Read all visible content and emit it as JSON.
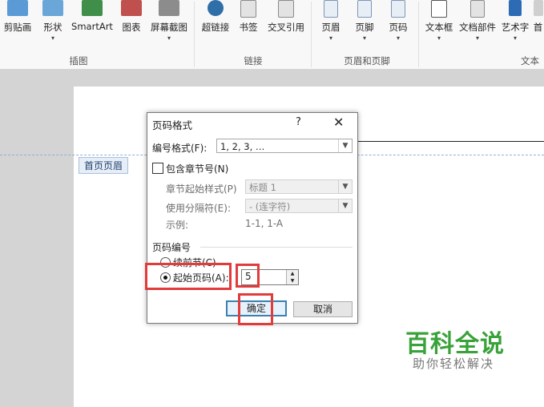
{
  "ribbon": {
    "buttons": [
      {
        "label": "剪贴画",
        "icon": "clipart-icon",
        "has_arrow": false
      },
      {
        "label": "形状",
        "icon": "shapes-icon",
        "has_arrow": true
      },
      {
        "label": "SmartArt",
        "icon": "smartart-icon",
        "has_arrow": false
      },
      {
        "label": "图表",
        "icon": "chart-icon",
        "has_arrow": false
      },
      {
        "label": "屏幕截图",
        "icon": "screenshot-icon",
        "has_arrow": true
      },
      {
        "label": "超链接",
        "icon": "hyperlink-icon",
        "has_arrow": false
      },
      {
        "label": "书签",
        "icon": "bookmark-icon",
        "has_arrow": false
      },
      {
        "label": "交叉引用",
        "icon": "cross-reference-icon",
        "has_arrow": false
      },
      {
        "label": "页眉",
        "icon": "header-icon",
        "has_arrow": true
      },
      {
        "label": "页脚",
        "icon": "footer-icon",
        "has_arrow": true
      },
      {
        "label": "页码",
        "icon": "page-number-icon",
        "has_arrow": true
      },
      {
        "label": "文本框",
        "icon": "textbox-icon",
        "has_arrow": true
      },
      {
        "label": "文档部件",
        "icon": "quick-parts-icon",
        "has_arrow": true
      },
      {
        "label": "艺术字",
        "icon": "wordart-icon",
        "has_arrow": true
      },
      {
        "label": "首",
        "icon": "drop-cap-icon",
        "has_arrow": false
      }
    ],
    "groups": [
      "插图",
      "链接",
      "页眉和页脚",
      "文本"
    ]
  },
  "document": {
    "header_tag": "首页页眉"
  },
  "dialog": {
    "title": "页码格式",
    "help": "?",
    "close": "✕",
    "number_format_label": "编号格式(F):",
    "number_format_value": "1, 2, 3, …",
    "include_chapter_label": "包含章节号(N)",
    "include_chapter_checked": false,
    "chapter_style_label": "章节起始样式(P)",
    "chapter_style_value": "标题 1",
    "separator_label": "使用分隔符(E):",
    "separator_value": "-  (连字符)",
    "example_label": "示例:",
    "example_value": "1-1, 1-A",
    "page_numbering_label": "页码编号",
    "continue_label": "续前节(C)",
    "start_at_label": "起始页码(A):",
    "start_at_selected": true,
    "start_at_value": "5",
    "ok_label": "确定",
    "cancel_label": "取消"
  },
  "watermark": {
    "main": "百科全说",
    "sub": "助你轻松解决"
  },
  "colors": {
    "highlight": "#e23b3b",
    "watermark": "#3aa23a",
    "default_button": "#3c7fb1"
  }
}
